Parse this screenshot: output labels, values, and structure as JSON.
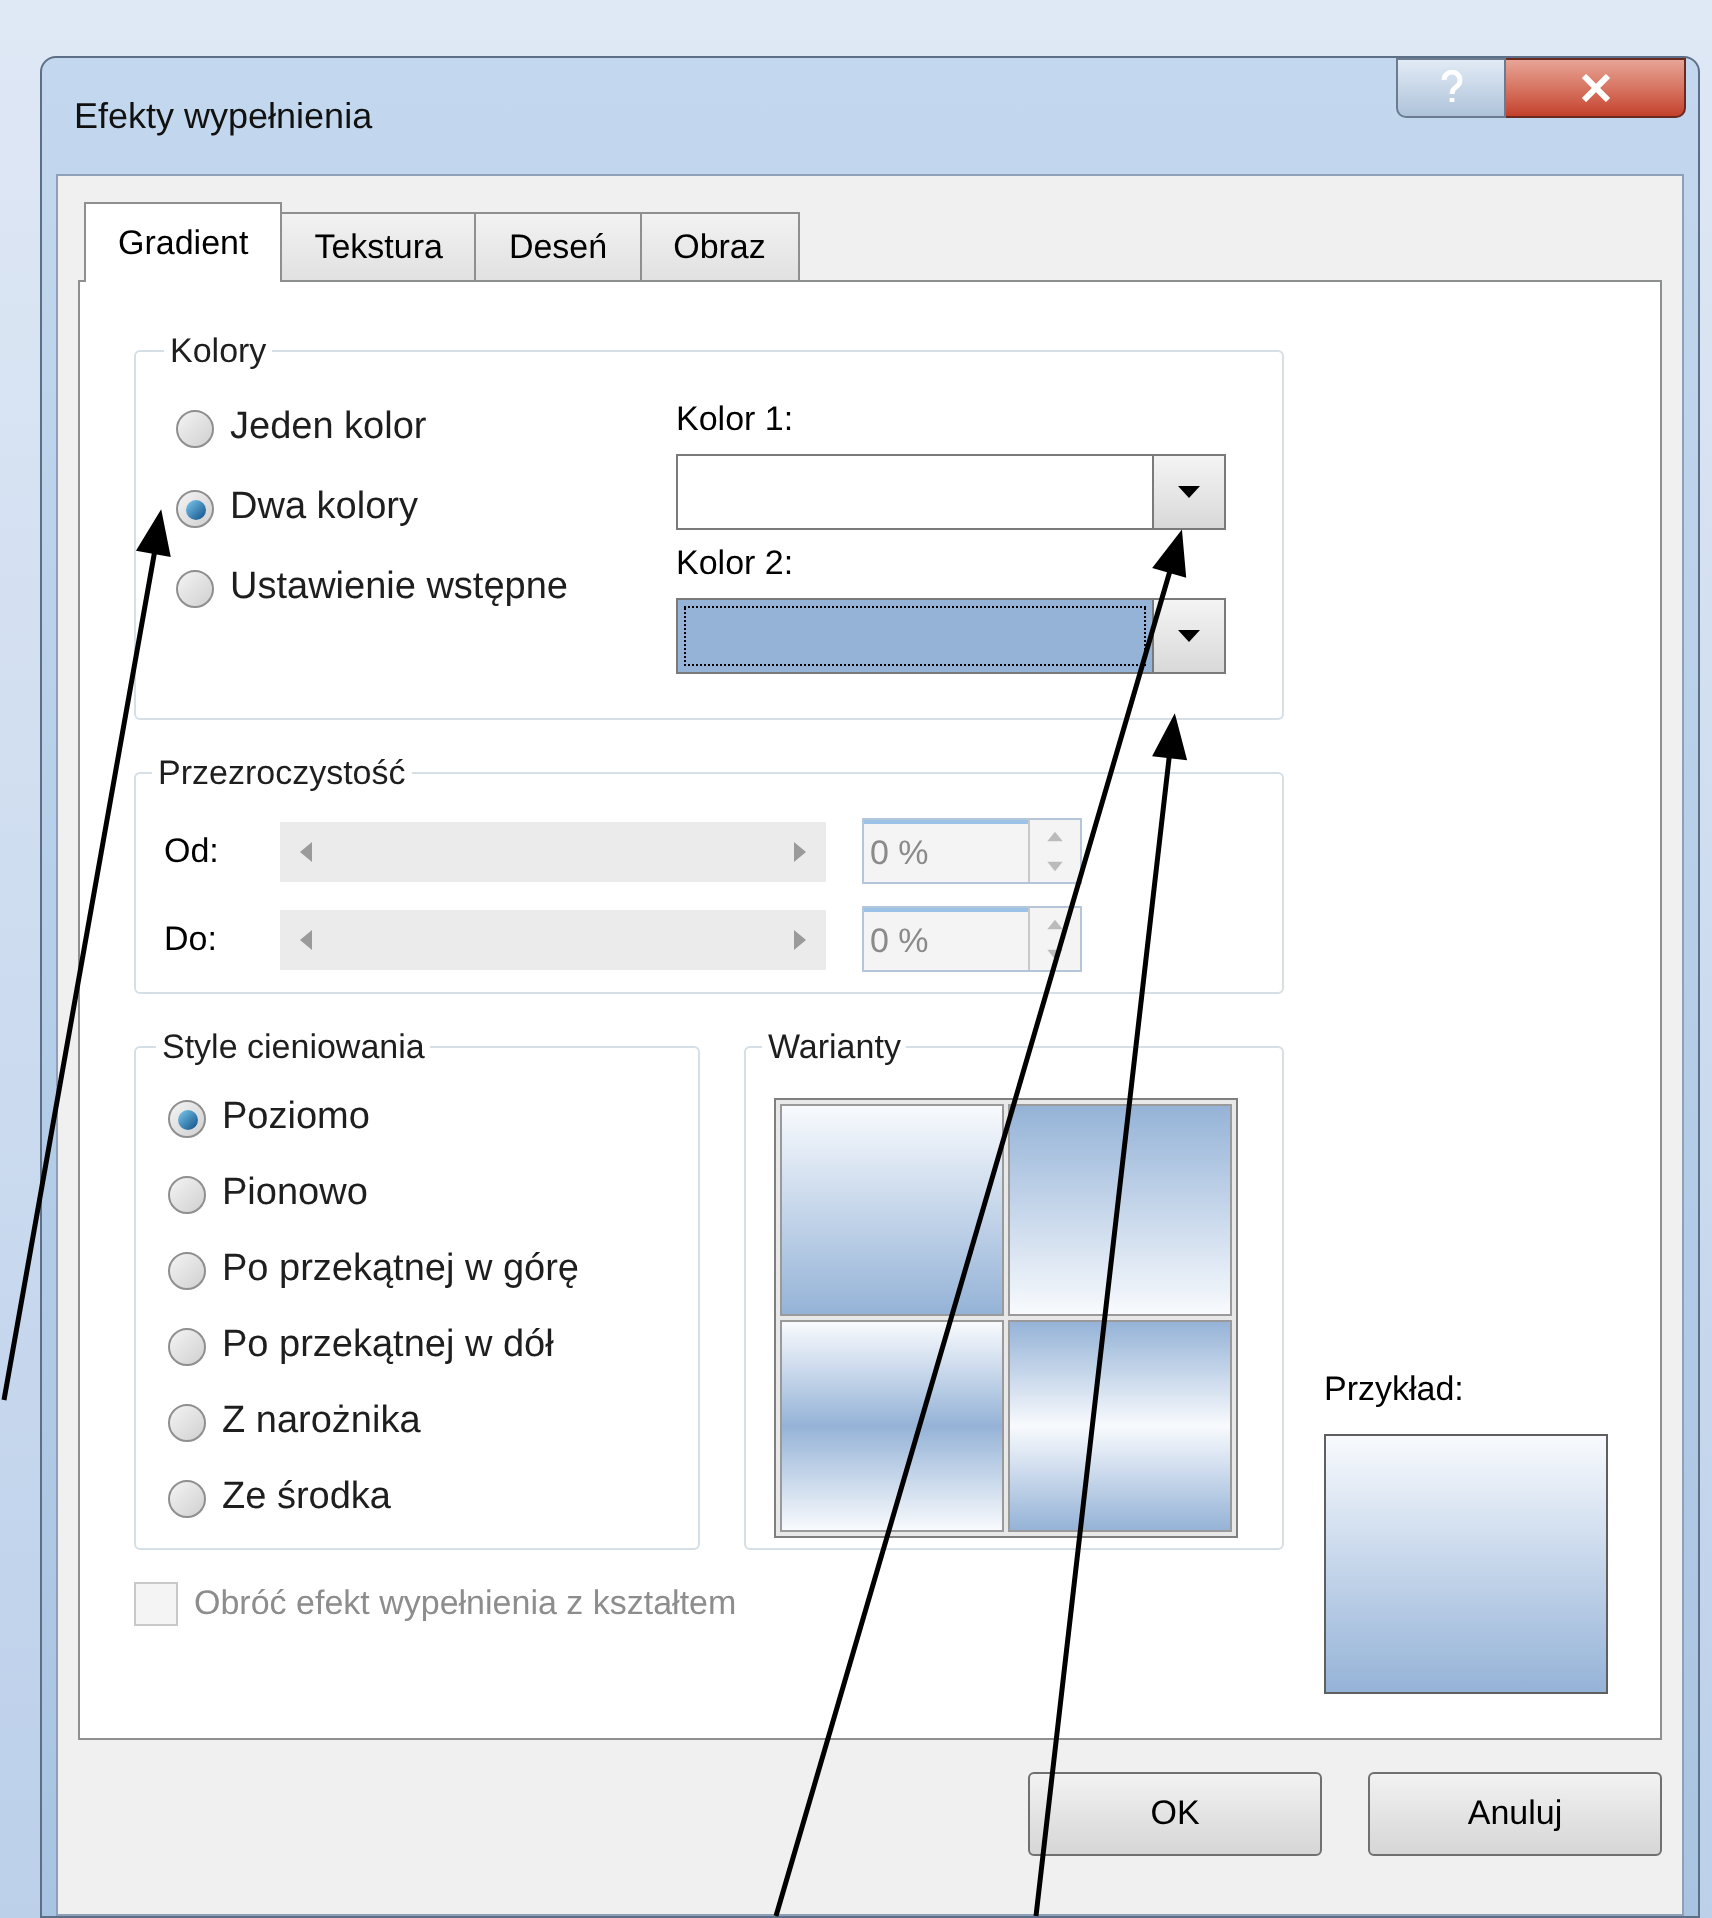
{
  "dialog": {
    "title": "Efekty wypełnienia"
  },
  "tabs": [
    {
      "label": "Gradient",
      "selected": true
    },
    {
      "label": "Tekstura",
      "selected": false
    },
    {
      "label": "Deseń",
      "selected": false
    },
    {
      "label": "Obraz",
      "selected": false
    }
  ],
  "colors_group": {
    "title": "Kolory",
    "options": [
      {
        "label": "Jeden kolor",
        "selected": false
      },
      {
        "label": "Dwa kolory",
        "selected": true
      },
      {
        "label": "Ustawienie wstępne",
        "selected": false
      }
    ],
    "pickers": [
      {
        "label": "Kolor 1:",
        "color": "#ffffff",
        "focused": false
      },
      {
        "label": "Kolor 2:",
        "color": "#95b3d7",
        "focused": true
      }
    ]
  },
  "transparency_group": {
    "title": "Przezroczystość",
    "rows": [
      {
        "label": "Od:",
        "value": "0 %"
      },
      {
        "label": "Do:",
        "value": "0 %"
      }
    ]
  },
  "shading_group": {
    "title": "Style cieniowania",
    "options": [
      {
        "label": "Poziomo",
        "selected": true
      },
      {
        "label": "Pionowo",
        "selected": false
      },
      {
        "label": "Po przekątnej w górę",
        "selected": false
      },
      {
        "label": "Po przekątnej w dół",
        "selected": false
      },
      {
        "label": "Z narożnika",
        "selected": false
      },
      {
        "label": "Ze środka",
        "selected": false
      }
    ]
  },
  "variants_group": {
    "title": "Warianty"
  },
  "preview": {
    "label": "Przykład:"
  },
  "rotate_checkbox": {
    "label": "Obróć efekt wypełnienia z kształtem",
    "checked": false,
    "disabled": true
  },
  "buttons": [
    "OK",
    "Anuluj"
  ]
}
